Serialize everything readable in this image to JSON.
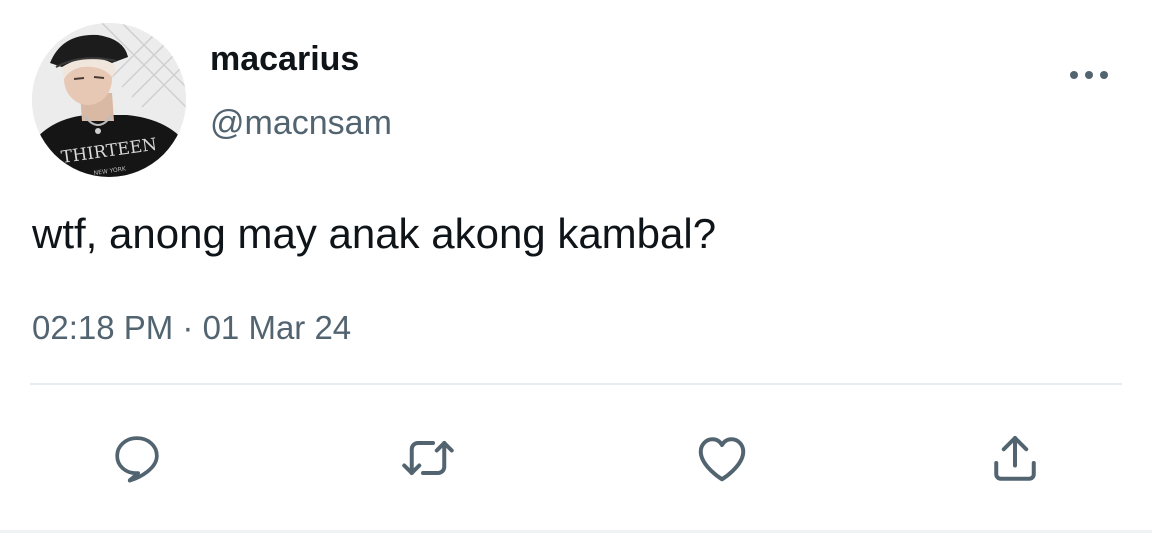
{
  "user": {
    "display_name": "macarius",
    "handle": "@macnsam",
    "avatar_shirt_text": "THIRTEEN",
    "avatar_shirt_subtext": "NEW YORK"
  },
  "tweet": {
    "text": "wtf, anong may anak akong kambal?",
    "timestamp": "02:18 PM · 01 Mar 24"
  },
  "actions": [
    "reply-icon",
    "retweet-icon",
    "like-icon",
    "share-icon"
  ],
  "colors": {
    "primary_text": "#0f1419",
    "secondary_text": "#536471",
    "icon": "#536471",
    "divider": "#e6ecf0"
  }
}
